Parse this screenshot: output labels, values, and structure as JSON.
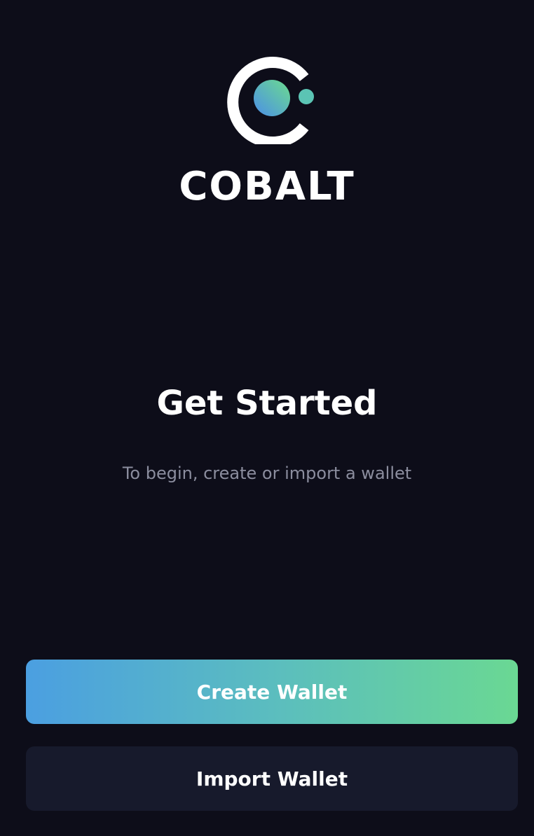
{
  "brand": {
    "name": "COBALT",
    "logo_icon": "cobalt-logo-icon"
  },
  "onboarding": {
    "title": "Get Started",
    "subtitle": "To begin, create or import a wallet"
  },
  "actions": {
    "create_label": "Create Wallet",
    "import_label": "Import Wallet"
  },
  "colors": {
    "background": "#0d0d19",
    "gradient_start": "#4b9fe1",
    "gradient_end": "#6ad893",
    "secondary_button": "#171a2c",
    "subtitle_text": "#8b8d9e"
  }
}
